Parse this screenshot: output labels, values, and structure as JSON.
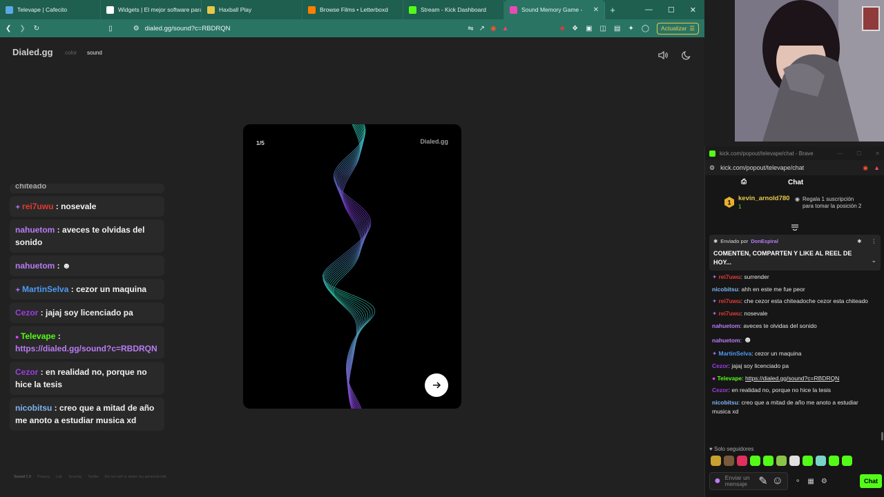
{
  "browser": {
    "tabs": [
      {
        "label": "Televape | Cafecito",
        "color": "#5aa9e6"
      },
      {
        "label": "Widgets | El mejor software para",
        "color": "#ffffff"
      },
      {
        "label": "Haxball Play",
        "color": "#e8c84a"
      },
      {
        "label": "Browse Films • Letterboxd",
        "color": "#ff8000"
      },
      {
        "label": "Stream - Kick Dashboard",
        "color": "#53fc18"
      },
      {
        "label": "Sound Memory Game -",
        "color": "#e84ab5",
        "active": true
      }
    ],
    "url": "dialed.gg/sound?c=RBDRQN",
    "update_label": "Actualizar"
  },
  "site": {
    "brand": "Dialed.gg",
    "nav_color": "color",
    "nav_sound": "sound",
    "card_counter": "1/5",
    "card_brand": "Dialed.gg",
    "footer": [
      "Sound 1.0",
      "Privacy",
      "Lab",
      "Scoring",
      "Tactile",
      "Do not sell or share my personal info"
    ]
  },
  "overlay_chat": {
    "cut_text": "chiteado",
    "messages": [
      {
        "user": "rei7uwu",
        "color": "#e53935",
        "text": "nosevale",
        "icon": true
      },
      {
        "user": "nahuetom",
        "color": "#b97cf6",
        "text": "aveces te olvidas del sonido"
      },
      {
        "user": "nahuetom",
        "color": "#b97cf6",
        "text": "",
        "emote": true
      },
      {
        "user": "MartinSelva",
        "color": "#4c9bf5",
        "text": "cezor un maquina",
        "icon": true
      },
      {
        "user": "Cezor",
        "color": "#9b3fe0",
        "text": "jajaj soy licenciado pa"
      },
      {
        "user": "Televape",
        "color": "#53fc18",
        "text": "https://dialed.gg/sound?c=RBDRQN",
        "link": true,
        "mic": true
      },
      {
        "user": "Cezor",
        "color": "#9b3fe0",
        "text": "en realidad no, porque no hice la tesis"
      },
      {
        "user": "nicobitsu",
        "color": "#7fb5f5",
        "text": "creo que a mitad de año me anoto a estudiar musica xd"
      }
    ]
  },
  "popup": {
    "title": "kick.com/popout/televape/chat - Brave",
    "address": "kick.com/popout/televape/chat",
    "chat_label": "Chat",
    "leader_name": "kevin_arnold780",
    "leader_count": "1",
    "gift_text_1": "Regala 1 suscripción",
    "gift_text_2": "para tomar la posición 2",
    "pinned_by": "Enviado por",
    "pinned_user": "DonEspiral",
    "pinned_text": "COMENTEN, COMPARTEN Y LIKE AL REEL DE HOY...",
    "messages": [
      {
        "user": "rei7uwu",
        "color": "#e53935",
        "text": "surrender",
        "icon": true
      },
      {
        "user": "nicobitsu",
        "color": "#7fb5f5",
        "text": "ahh en este me fue peor"
      },
      {
        "user": "rei7uwu",
        "color": "#e53935",
        "text": "che cezor esta chiteadoche cezor esta chiteado",
        "icon": true
      },
      {
        "user": "rei7uwu",
        "color": "#e53935",
        "text": "nosevale",
        "icon": true
      },
      {
        "user": "nahuetom",
        "color": "#b97cf6",
        "text": "aveces te olvidas del sonido"
      },
      {
        "user": "nahuetom",
        "color": "#b97cf6",
        "text": "",
        "emote": true
      },
      {
        "user": "MartinSelva",
        "color": "#4c9bf5",
        "text": "cezor un maquina",
        "icon": true
      },
      {
        "user": "Cezor",
        "color": "#9b3fe0",
        "text": "jajaj soy licenciado pa"
      },
      {
        "user": "Televape",
        "color": "#53fc18",
        "text": "https://dialed.gg/sound?c=RBDRQN",
        "link": true,
        "mic": true
      },
      {
        "user": "Cezor",
        "color": "#9b3fe0",
        "text": "en realidad no, porque no hice la tesis"
      },
      {
        "user": "nicobitsu",
        "color": "#7fb5f5",
        "text": "creo que a mitad de año me anoto a estudiar musica xd"
      }
    ],
    "solo_label": "Solo seguidores",
    "emote_colors": [
      "#c8a030",
      "#7a5a3a",
      "#e03060",
      "#53fc18",
      "#53fc18",
      "#8bc34a",
      "#e0e0e0",
      "#53fc18",
      "#7ad3c8",
      "#53fc18",
      "#53fc18"
    ],
    "input_placeholder": "Enviar un mensaje",
    "send_label": "Chat"
  }
}
